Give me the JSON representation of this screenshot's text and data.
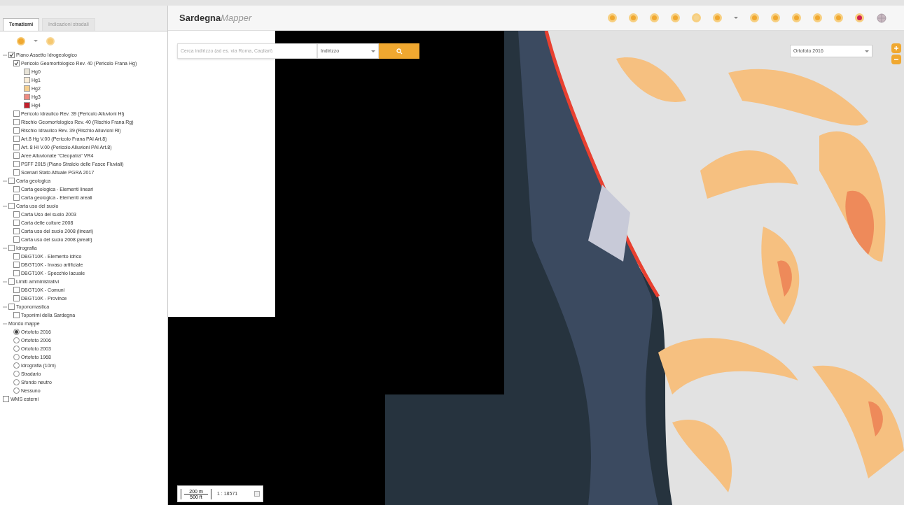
{
  "sidebar": {
    "tabs": [
      {
        "label": "Tematismi",
        "selected": true
      },
      {
        "label": "Indicazioni stradali",
        "selected": false
      }
    ],
    "tree": [
      {
        "label": "Piano Assetto Idrogeologico",
        "kind": "check",
        "checked": true,
        "expanded": true,
        "children": [
          {
            "label": "Pericolo Geomorfologico Rev. 40 (Pericolo Frana Hg)",
            "kind": "check",
            "checked": true,
            "children": [
              {
                "label": "Hg0",
                "kind": "legend",
                "color": "#e8e4d8"
              },
              {
                "label": "Hg1",
                "kind": "legend",
                "color": "#fbeed8"
              },
              {
                "label": "Hg2",
                "kind": "legend",
                "color": "#f6cf8e"
              },
              {
                "label": "Hg3",
                "kind": "legend",
                "color": "#f08a80"
              },
              {
                "label": "Hg4",
                "kind": "legend",
                "color": "#c4202c"
              }
            ]
          },
          {
            "label": "Pericolo Idraulico Rev. 39 (Pericolo Alluvioni Hi)",
            "kind": "check",
            "checked": false
          },
          {
            "label": "Rischio Geomorfologico Rev. 40 (Rischio Frana Rg)",
            "kind": "check",
            "checked": false
          },
          {
            "label": "Rischio Idraulico Rev. 39 (Rischio Alluvioni Ri)",
            "kind": "check",
            "checked": false
          },
          {
            "label": "Art.8 Hg V.00 (Pericolo Frana PAI Art.8)",
            "kind": "check",
            "checked": false
          },
          {
            "label": "Art. 8 Hi V.00 (Pericolo Alluvioni PAI Art.8)",
            "kind": "check",
            "checked": false
          },
          {
            "label": "Aree Alluvionate \"Cleopatra\" VR4",
            "kind": "check",
            "checked": false
          },
          {
            "label": "PSFF 2015 (Piano Stralcio delle Fasce Fluviali)",
            "kind": "check",
            "checked": false
          },
          {
            "label": "Scenari Stato Attuale PGRA 2017",
            "kind": "check",
            "checked": false
          }
        ]
      },
      {
        "label": "Carta geologica",
        "kind": "check",
        "checked": false,
        "expanded": true,
        "children": [
          {
            "label": "Carta geologica - Elementi lineari",
            "kind": "check",
            "checked": false
          },
          {
            "label": "Carta geologica - Elementi areali",
            "kind": "check",
            "checked": false
          }
        ]
      },
      {
        "label": "Carta uso del suolo",
        "kind": "check",
        "checked": false,
        "expanded": true,
        "children": [
          {
            "label": "Carta Uso del suolo 2003",
            "kind": "check",
            "checked": false
          },
          {
            "label": "Carta delle colture 2008",
            "kind": "check",
            "checked": false
          },
          {
            "label": "Carta uso del suolo 2008 (lineari)",
            "kind": "check",
            "checked": false
          },
          {
            "label": "Carta uso del suolo 2008 (areali)",
            "kind": "check",
            "checked": false
          }
        ]
      },
      {
        "label": "Idrografia",
        "kind": "check",
        "checked": false,
        "expanded": true,
        "children": [
          {
            "label": "DBGT10K - Elemento idrico",
            "kind": "check",
            "checked": false
          },
          {
            "label": "DBGT10K - Invaso artificiale",
            "kind": "check",
            "checked": false
          },
          {
            "label": "DBGT10K - Specchio lacuale",
            "kind": "check",
            "checked": false
          }
        ]
      },
      {
        "label": "Limiti amministrativi",
        "kind": "check",
        "checked": false,
        "expanded": true,
        "children": [
          {
            "label": "DBGT10K - Comuni",
            "kind": "check",
            "checked": false
          },
          {
            "label": "DBGT10K - Province",
            "kind": "check",
            "checked": false
          }
        ]
      },
      {
        "label": "Toponomastica",
        "kind": "check",
        "checked": false,
        "expanded": true,
        "children": [
          {
            "label": "Toponimi della Sardegna",
            "kind": "check",
            "checked": false
          }
        ]
      },
      {
        "label": "Mondo mappe",
        "kind": "group",
        "expanded": true,
        "children": [
          {
            "label": "Ortofoto 2016",
            "kind": "radio",
            "selected": true
          },
          {
            "label": "Ortofoto 2006",
            "kind": "radio",
            "selected": false
          },
          {
            "label": "Ortofoto 2003",
            "kind": "radio",
            "selected": false
          },
          {
            "label": "Ortofoto 1968",
            "kind": "radio",
            "selected": false
          },
          {
            "label": "Idrografia (10m)",
            "kind": "radio",
            "selected": false
          },
          {
            "label": "Stradario",
            "kind": "radio",
            "selected": false
          },
          {
            "label": "Sfondo neutro",
            "kind": "radio",
            "selected": false
          },
          {
            "label": "Nessuno",
            "kind": "radio",
            "selected": false
          }
        ]
      },
      {
        "label": "WMS esterni",
        "kind": "check",
        "checked": false
      }
    ]
  },
  "header": {
    "logo_bold": "Sardegna",
    "logo_light": "Mapper"
  },
  "search": {
    "placeholder": "Cerca indirizzo (ad es. via Roma, Cagliari)",
    "type": "Indirizzo"
  },
  "basemap_select": "Ortofoto 2016",
  "scale": {
    "bar_top": "200 m",
    "bar_bottom": "500 ft",
    "ratio": "1 : 18571"
  }
}
